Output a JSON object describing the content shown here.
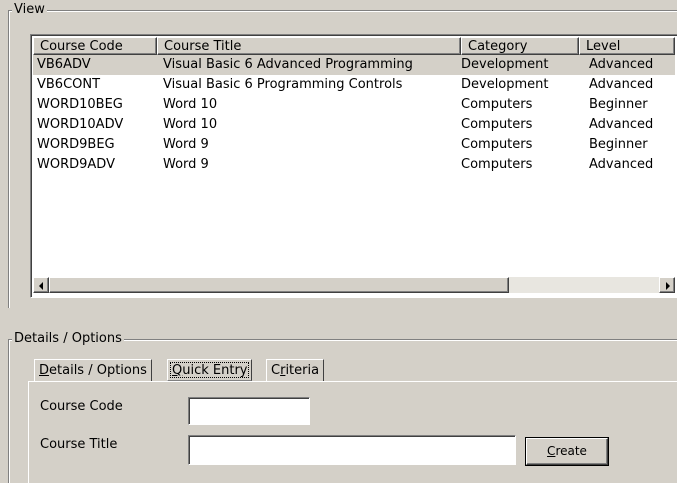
{
  "view_group": {
    "title": "View"
  },
  "listview": {
    "columns": [
      "Course Code",
      "Course Title",
      "Category",
      "Level"
    ],
    "rows": [
      [
        "VB6ADV",
        "Visual Basic 6 Advanced Programming",
        "Development",
        "Advanced"
      ],
      [
        "VB6CONT",
        "Visual Basic 6 Programming Controls",
        "Development",
        "Advanced"
      ],
      [
        "WORD10BEG",
        "Word 10",
        "Computers",
        "Beginner"
      ],
      [
        "WORD10ADV",
        "Word 10",
        "Computers",
        "Advanced"
      ],
      [
        "WORD9BEG",
        "Word 9",
        "Computers",
        "Beginner"
      ],
      [
        "WORD9ADV",
        "Word 9",
        "Computers",
        "Advanced"
      ]
    ],
    "selected_row": 0
  },
  "details_group": {
    "title": "Details / Options"
  },
  "tabs": [
    {
      "mnemonic": "D",
      "rest": "etails / Options"
    },
    {
      "mnemonic": "Q",
      "rest": "uick Entry"
    },
    {
      "prefix": "C",
      "mnemonic": "r",
      "rest": "iteria"
    }
  ],
  "active_tab": 1,
  "form": {
    "course_code_label": "Course Code",
    "course_code_value": "",
    "course_title_label": "Course Title",
    "course_title_value": "",
    "create_button": {
      "mnemonic": "C",
      "rest": "reate"
    }
  }
}
